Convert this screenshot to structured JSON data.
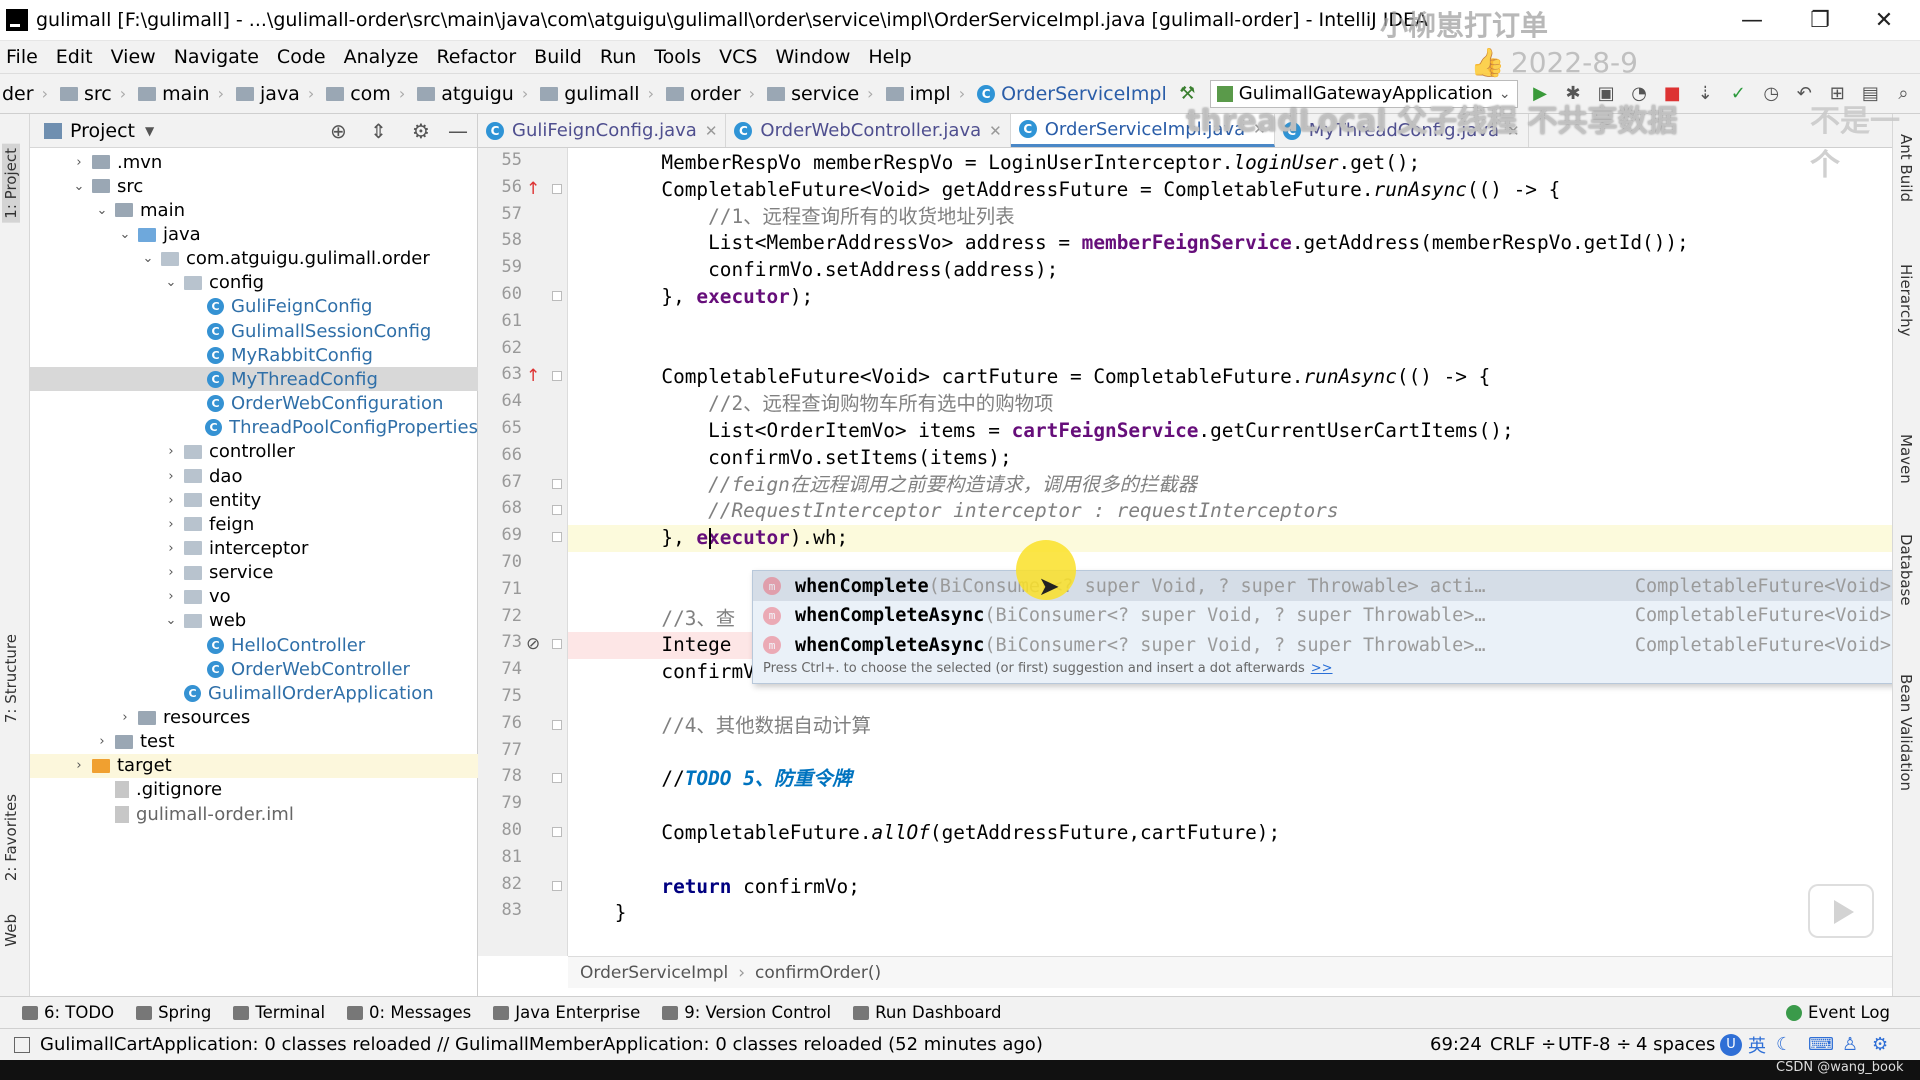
{
  "window": {
    "title": "gulimall [F:\\gulimall] - ...\\gulimall-order\\src\\main\\java\\com\\atguigu\\gulimall\\order\\service\\impl\\OrderServiceImpl.java [gulimall-order] - IntelliJ IDEA",
    "minimize": "—",
    "restore": "❐",
    "close": "✕"
  },
  "menu": [
    "File",
    "Edit",
    "View",
    "Navigate",
    "Code",
    "Analyze",
    "Refactor",
    "Build",
    "Run",
    "Tools",
    "VCS",
    "Window",
    "Help"
  ],
  "breadcrumbs": [
    "der",
    "src",
    "main",
    "java",
    "com",
    "atguigu",
    "gulimall",
    "order",
    "service",
    "impl",
    "OrderServiceImpl"
  ],
  "run_config": "GulimallGatewayApplication",
  "project_panel": {
    "title": "Project",
    "tree": [
      {
        "label": ".mvn",
        "depth": 2,
        "arrow": "right",
        "kind": "folder"
      },
      {
        "label": "src",
        "depth": 2,
        "arrow": "down",
        "kind": "folder"
      },
      {
        "label": "main",
        "depth": 3,
        "arrow": "down",
        "kind": "folder"
      },
      {
        "label": "java",
        "depth": 4,
        "arrow": "down",
        "kind": "blue"
      },
      {
        "label": "com.atguigu.gulimall.order",
        "depth": 5,
        "arrow": "down",
        "kind": "pkg"
      },
      {
        "label": "config",
        "depth": 6,
        "arrow": "down",
        "kind": "pkg"
      },
      {
        "label": "GuliFeignConfig",
        "depth": 7,
        "arrow": "",
        "kind": "class"
      },
      {
        "label": "GulimallSessionConfig",
        "depth": 7,
        "arrow": "",
        "kind": "class"
      },
      {
        "label": "MyRabbitConfig",
        "depth": 7,
        "arrow": "",
        "kind": "class"
      },
      {
        "label": "MyThreadConfig",
        "depth": 7,
        "arrow": "",
        "kind": "class",
        "selected": true
      },
      {
        "label": "OrderWebConfiguration",
        "depth": 7,
        "arrow": "",
        "kind": "class"
      },
      {
        "label": "ThreadPoolConfigProperties",
        "depth": 7,
        "arrow": "",
        "kind": "class"
      },
      {
        "label": "controller",
        "depth": 6,
        "arrow": "right",
        "kind": "pkg"
      },
      {
        "label": "dao",
        "depth": 6,
        "arrow": "right",
        "kind": "pkg"
      },
      {
        "label": "entity",
        "depth": 6,
        "arrow": "right",
        "kind": "pkg"
      },
      {
        "label": "feign",
        "depth": 6,
        "arrow": "right",
        "kind": "pkg"
      },
      {
        "label": "interceptor",
        "depth": 6,
        "arrow": "right",
        "kind": "pkg"
      },
      {
        "label": "service",
        "depth": 6,
        "arrow": "right",
        "kind": "pkg"
      },
      {
        "label": "vo",
        "depth": 6,
        "arrow": "right",
        "kind": "pkg"
      },
      {
        "label": "web",
        "depth": 6,
        "arrow": "down",
        "kind": "pkg"
      },
      {
        "label": "HelloController",
        "depth": 7,
        "arrow": "",
        "kind": "class"
      },
      {
        "label": "OrderWebController",
        "depth": 7,
        "arrow": "",
        "kind": "class"
      },
      {
        "label": "GulimallOrderApplication",
        "depth": 6,
        "arrow": "",
        "kind": "class"
      },
      {
        "label": "resources",
        "depth": 4,
        "arrow": "right",
        "kind": "folder"
      },
      {
        "label": "test",
        "depth": 3,
        "arrow": "right",
        "kind": "folder"
      },
      {
        "label": "target",
        "depth": 2,
        "arrow": "right",
        "kind": "orange",
        "highlight": true
      },
      {
        "label": ".gitignore",
        "depth": 3,
        "arrow": "",
        "kind": "file"
      },
      {
        "label": "gulimall-order.iml",
        "depth": 3,
        "arrow": "",
        "kind": "file"
      }
    ]
  },
  "editor_tabs": [
    {
      "label": "GuliFeignConfig.java",
      "active": false
    },
    {
      "label": "OrderWebController.java",
      "active": false
    },
    {
      "label": "OrderServiceImpl.java",
      "active": true
    },
    {
      "label": "MyThreadConfig.java",
      "active": false
    }
  ],
  "line_numbers": [
    "55",
    "56",
    "57",
    "58",
    "59",
    "60",
    "61",
    "62",
    "63",
    "64",
    "65",
    "66",
    "67",
    "68",
    "69",
    "70",
    "71",
    "72",
    "73",
    "74",
    "75",
    "76",
    "77",
    "78",
    "79",
    "80",
    "81",
    "82",
    "83"
  ],
  "code_lines": [
    [
      [
        "        MemberRespVo memberRespVo = LoginUserInterceptor.",
        ""
      ],
      [
        "loginUser",
        "st"
      ],
      [
        ".get();",
        ""
      ]
    ],
    [
      [
        "        CompletableFuture<Void> getAddressFuture = CompletableFuture.",
        ""
      ],
      [
        "runAsync",
        "st"
      ],
      [
        "(() -> {",
        ""
      ]
    ],
    [
      [
        "            //1、远程查询所有的收货地址列表",
        "ccmt"
      ]
    ],
    [
      [
        "            List<MemberAddressVo> address = ",
        ""
      ],
      [
        "memberFeignService",
        "fld"
      ],
      [
        ".getAddress(memberRespVo.getId());",
        ""
      ]
    ],
    [
      [
        "            confirmVo.setAddress(address);",
        ""
      ]
    ],
    [
      [
        "        }, ",
        ""
      ],
      [
        "executor",
        "fld"
      ],
      [
        ");",
        ""
      ]
    ],
    [
      [
        "",
        ""
      ]
    ],
    [
      [
        "",
        ""
      ]
    ],
    [
      [
        "        CompletableFuture<Void> cartFuture = CompletableFuture.",
        ""
      ],
      [
        "runAsync",
        "st"
      ],
      [
        "(() -> {",
        ""
      ]
    ],
    [
      [
        "            //2、远程查询购物车所有选中的购物项",
        "ccmt"
      ]
    ],
    [
      [
        "            List<OrderItemVo> items = ",
        ""
      ],
      [
        "cartFeignService",
        "fld"
      ],
      [
        ".getCurrentUserCartItems();",
        ""
      ]
    ],
    [
      [
        "            confirmVo.setItems(items);",
        ""
      ]
    ],
    [
      [
        "            //feign在远程调用之前要构造请求，调用很多的拦截器",
        "cmt"
      ]
    ],
    [
      [
        "            //RequestInterceptor interceptor : requestInterceptors",
        "cmt"
      ]
    ],
    [
      [
        "        }, ",
        ""
      ],
      [
        "executor",
        "fld"
      ],
      [
        ").wh;",
        ""
      ]
    ],
    [
      [
        "",
        ""
      ]
    ],
    [
      [
        "",
        ""
      ]
    ],
    [
      [
        "        //3、查",
        "ccmt"
      ]
    ],
    [
      [
        "        Intege",
        ""
      ]
    ],
    [
      [
        "        confirmVo.setIntegration(integration);",
        ""
      ]
    ],
    [
      [
        "",
        ""
      ]
    ],
    [
      [
        "        //4、其他数据自动计算",
        "ccmt"
      ]
    ],
    [
      [
        "",
        ""
      ]
    ],
    [
      [
        "        //",
        ""
      ],
      [
        "TODO 5、防重令牌",
        "todo"
      ]
    ],
    [
      [
        "",
        ""
      ]
    ],
    [
      [
        "        CompletableFuture.",
        ""
      ],
      [
        "allOf",
        "st"
      ],
      [
        "(getAddressFuture,cartFuture);",
        ""
      ]
    ],
    [
      [
        "",
        ""
      ]
    ],
    [
      [
        "        ",
        ""
      ],
      [
        "return",
        "kw"
      ],
      [
        " confirmVo;",
        ""
      ]
    ],
    [
      [
        "    }",
        ""
      ]
    ]
  ],
  "completion": {
    "items": [
      {
        "name": "whenComplete",
        "sig": "(BiConsumer<? super Void, ? super Throwable> acti…",
        "ret": "CompletableFuture<Void>"
      },
      {
        "name": "whenCompleteAsync",
        "sig": "(BiConsumer<? super Void, ? super Throwable>…",
        "ret": "CompletableFuture<Void>"
      },
      {
        "name": "whenCompleteAsync",
        "sig": "(BiConsumer<? super Void, ? super Throwable>…",
        "ret": "CompletableFuture<Void>"
      }
    ],
    "hint": "Press Ctrl+. to choose the selected (or first) suggestion and insert a dot afterwards",
    "hint_link": ">>"
  },
  "code_breadcrumb": [
    "OrderServiceImpl",
    "confirmOrder()"
  ],
  "tool_windows": [
    "6: TODO",
    "Spring",
    "Terminal",
    "0: Messages",
    "Java Enterprise",
    "9: Version Control",
    "Run Dashboard"
  ],
  "event_log": "Event Log",
  "status": {
    "message": "GulimallCartApplication: 0 classes reloaded // GulimallMemberApplication: 0 classes reloaded (52 minutes ago)",
    "position": "69:24",
    "line_sep": "CRLF ÷",
    "encoding": "UTF-8 ÷",
    "indent": "4 spaces",
    "ime": "英"
  },
  "left_strip": [
    "1: Project",
    "7: Structure",
    "2: Favorites",
    "Web"
  ],
  "right_strip": [
    "Ant Build",
    "Hierarchy",
    "Maven",
    "Database",
    "Bean Validation"
  ],
  "overlays": {
    "watermark_title": "小柳崽打订单",
    "watermark_date": "2022-8-9",
    "caption": "threadLocal 父子线程 不共享数据",
    "caption_tail": "不是一个",
    "csdn": "CSDN @wang_book"
  }
}
